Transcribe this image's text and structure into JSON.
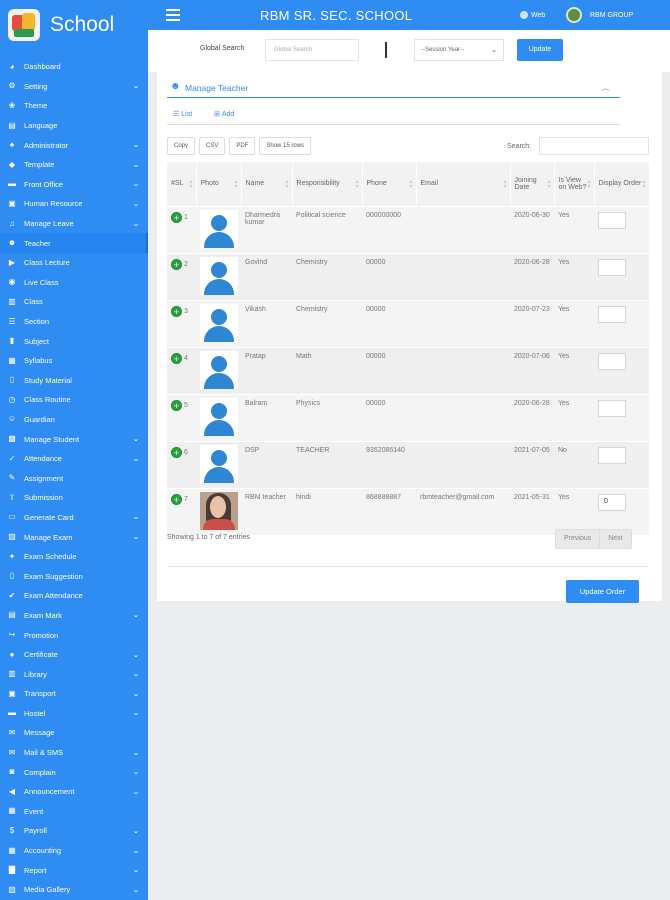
{
  "brand": {
    "name": "School"
  },
  "header": {
    "title": "RBM SR. SEC. SCHOOL",
    "web_label": "Web",
    "group_label": "RBM GROUP"
  },
  "global_search": {
    "label": "Global Search",
    "placeholder": "Global Search",
    "session_placeholder": "--Session Year--",
    "update_label": "Update"
  },
  "sidebar": {
    "items": [
      {
        "label": "Dashboard",
        "icon": "dashboard-icon",
        "glyph": "◕",
        "chevron": false
      },
      {
        "label": "Setting",
        "icon": "gears-icon",
        "glyph": "⚙",
        "chevron": true
      },
      {
        "label": "Theme",
        "icon": "theme-icon",
        "glyph": "❀",
        "chevron": false
      },
      {
        "label": "Language",
        "icon": "language-icon",
        "glyph": "▤",
        "chevron": false
      },
      {
        "label": "Administrator",
        "icon": "user-secret-icon",
        "glyph": "♠",
        "chevron": true
      },
      {
        "label": "Template",
        "icon": "tag-icon",
        "glyph": "◆",
        "chevron": true
      },
      {
        "label": "Front Office",
        "icon": "front-office-icon",
        "glyph": "▬",
        "chevron": true
      },
      {
        "label": "Human Resource",
        "icon": "briefcase-icon",
        "glyph": "▣",
        "chevron": true
      },
      {
        "label": "Manage Leave",
        "icon": "bell-icon",
        "glyph": "♫",
        "chevron": true
      },
      {
        "label": "Teacher",
        "icon": "users-icon",
        "glyph": "☻",
        "chevron": false,
        "active": true
      },
      {
        "label": "Class Lecture",
        "icon": "video-icon",
        "glyph": "▶",
        "chevron": false
      },
      {
        "label": "Live Class",
        "icon": "live-icon",
        "glyph": "◉",
        "chevron": false
      },
      {
        "label": "Class",
        "icon": "class-icon",
        "glyph": "▥",
        "chevron": false
      },
      {
        "label": "Section",
        "icon": "section-icon",
        "glyph": "☰",
        "chevron": false
      },
      {
        "label": "Subject",
        "icon": "book-icon",
        "glyph": "▮",
        "chevron": false
      },
      {
        "label": "Syllabus",
        "icon": "syllabus-icon",
        "glyph": "▦",
        "chevron": false
      },
      {
        "label": "Study Material",
        "icon": "file-icon",
        "glyph": "▯",
        "chevron": false
      },
      {
        "label": "Class Routine",
        "icon": "clock-icon",
        "glyph": "◷",
        "chevron": false
      },
      {
        "label": "Guardian",
        "icon": "guardian-icon",
        "glyph": "☺",
        "chevron": false
      },
      {
        "label": "Manage Student",
        "icon": "student-icon",
        "glyph": "▩",
        "chevron": true
      },
      {
        "label": "Attendance",
        "icon": "check-circle-icon",
        "glyph": "✓",
        "chevron": true
      },
      {
        "label": "Assignment",
        "icon": "assignment-icon",
        "glyph": "✎",
        "chevron": false
      },
      {
        "label": "Submission",
        "icon": "upload-icon",
        "glyph": "⇪",
        "chevron": false
      },
      {
        "label": "Generate Card",
        "icon": "card-icon",
        "glyph": "▭",
        "chevron": true
      },
      {
        "label": "Manage Exam",
        "icon": "exam-icon",
        "glyph": "▧",
        "chevron": true
      },
      {
        "label": "Exam Schedule",
        "icon": "pin-icon",
        "glyph": "✦",
        "chevron": false
      },
      {
        "label": "Exam Suggestion",
        "icon": "suggestion-icon",
        "glyph": "▯",
        "chevron": false
      },
      {
        "label": "Exam Attendance",
        "icon": "check-icon",
        "glyph": "✔",
        "chevron": false
      },
      {
        "label": "Exam Mark",
        "icon": "mark-icon",
        "glyph": "▤",
        "chevron": true
      },
      {
        "label": "Promotion",
        "icon": "share-icon",
        "glyph": "↪",
        "chevron": false
      },
      {
        "label": "Certificate",
        "icon": "certificate-icon",
        "glyph": "●",
        "chevron": true
      },
      {
        "label": "Library",
        "icon": "library-icon",
        "glyph": "▥",
        "chevron": true
      },
      {
        "label": "Transport",
        "icon": "bus-icon",
        "glyph": "▣",
        "chevron": true
      },
      {
        "label": "Hostel",
        "icon": "bed-icon",
        "glyph": "▬",
        "chevron": true
      },
      {
        "label": "Message",
        "icon": "message-icon",
        "glyph": "✉",
        "chevron": false
      },
      {
        "label": "Mail & SMS",
        "icon": "mail-icon",
        "glyph": "✉",
        "chevron": true
      },
      {
        "label": "Complain",
        "icon": "comment-icon",
        "glyph": "◙",
        "chevron": true
      },
      {
        "label": "Announcement",
        "icon": "bullhorn-icon",
        "glyph": "◀",
        "chevron": true
      },
      {
        "label": "Event",
        "icon": "calendar-icon",
        "glyph": "▦",
        "chevron": false
      },
      {
        "label": "Payroll",
        "icon": "dollar-icon",
        "glyph": "$",
        "chevron": true
      },
      {
        "label": "Accounting",
        "icon": "calculator-icon",
        "glyph": "▦",
        "chevron": true
      },
      {
        "label": "Report",
        "icon": "report-icon",
        "glyph": "▇",
        "chevron": true
      },
      {
        "label": "Media Gallery",
        "icon": "gallery-icon",
        "glyph": "▨",
        "chevron": true
      }
    ]
  },
  "panel": {
    "title": "Manage Teacher",
    "tabs": [
      {
        "label": "List"
      },
      {
        "label": "Add"
      }
    ],
    "export_buttons": [
      "Copy",
      "CSV",
      "PDF",
      "Show 15 rows"
    ],
    "search_label": "Search:",
    "columns": [
      "#SL",
      "Photo",
      "Name",
      "Responsibility",
      "Phone",
      "Email",
      "Joining Date",
      "Is View on Web?",
      "Display Order"
    ],
    "rows": [
      {
        "sl": "1",
        "name": "Dharmedra kumar",
        "responsibility": "Political science",
        "phone": "000000000",
        "email": "",
        "joining": "2020-06-30",
        "view": "Yes",
        "order": "",
        "photo": "placeholder"
      },
      {
        "sl": "2",
        "name": "Govind",
        "responsibility": "Chemistry",
        "phone": "00000",
        "email": "",
        "joining": "2020-06-28",
        "view": "Yes",
        "order": "",
        "photo": "placeholder"
      },
      {
        "sl": "3",
        "name": "Vikash",
        "responsibility": "Chemistry",
        "phone": "00000",
        "email": "",
        "joining": "2020-07-23",
        "view": "Yes",
        "order": "",
        "photo": "placeholder"
      },
      {
        "sl": "4",
        "name": "Pratap",
        "responsibility": "Math",
        "phone": "00000",
        "email": "",
        "joining": "2020-07-06",
        "view": "Yes",
        "order": "",
        "photo": "placeholder"
      },
      {
        "sl": "5",
        "name": "Balram",
        "responsibility": "Physics",
        "phone": "00000",
        "email": "",
        "joining": "2020-06-28",
        "view": "Yes",
        "order": "",
        "photo": "placeholder"
      },
      {
        "sl": "6",
        "name": "DSP",
        "responsibility": "TEACHER",
        "phone": "9352086140",
        "email": "",
        "joining": "2021-07-05",
        "view": "No",
        "order": "",
        "photo": "placeholder"
      },
      {
        "sl": "7",
        "name": "RBM teacher",
        "responsibility": "hindi",
        "phone": "868888887",
        "email": "rbmteacher@gmail.com",
        "joining": "2021-05-31",
        "view": "Yes",
        "order": "0",
        "photo": "real"
      }
    ],
    "showing_text": "Showing 1 to 7 of 7 entries",
    "pager": {
      "previous": "Previous",
      "next": "Next"
    },
    "update_order_label": "Update Order"
  }
}
